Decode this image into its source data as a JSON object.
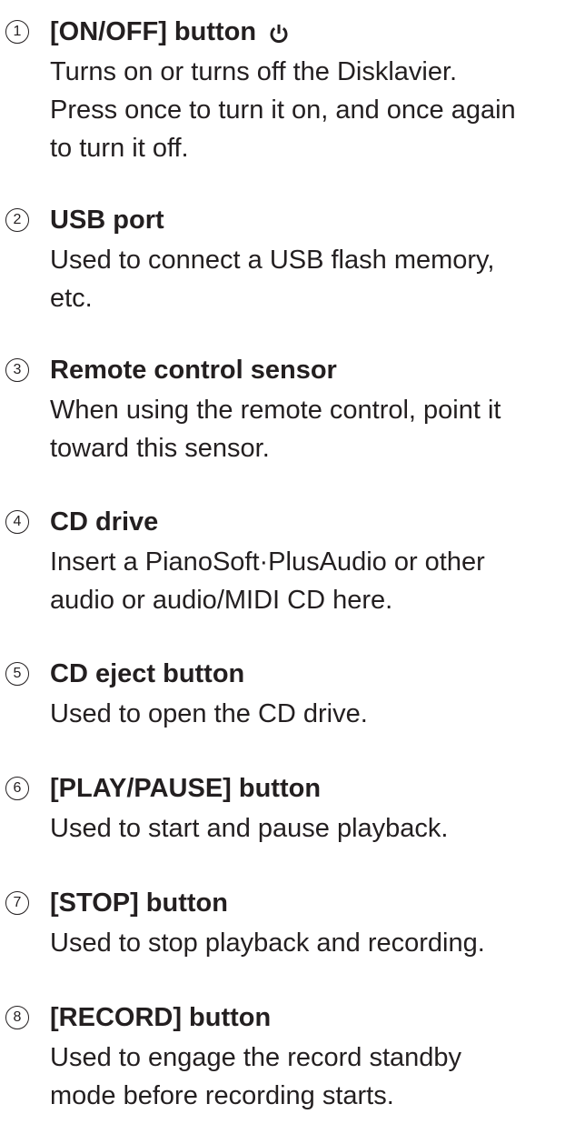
{
  "items": [
    {
      "number": "1",
      "title": "[ON/OFF] button",
      "icon": "power-icon",
      "lines": [
        "Turns on or turns off the Disklavier.",
        "Press once to turn it on, and once again",
        "to turn it off."
      ]
    },
    {
      "number": "2",
      "title": "USB port",
      "lines": [
        "Used to connect a USB flash memory,",
        "etc."
      ]
    },
    {
      "number": "3",
      "title": "Remote control sensor",
      "lines": [
        "When using the remote control, point it",
        "toward this sensor."
      ]
    },
    {
      "number": "4",
      "title": "CD drive",
      "lines": [
        "Insert a PianoSoft·PlusAudio or other",
        "audio or audio/MIDI CD here."
      ]
    },
    {
      "number": "5",
      "title": "CD eject button",
      "lines": [
        "Used to open the CD drive."
      ]
    },
    {
      "number": "6",
      "title": "[PLAY/PAUSE] button",
      "lines": [
        "Used to start and pause playback."
      ]
    },
    {
      "number": "7",
      "title": "[STOP] button",
      "lines": [
        "Used to stop playback and recording."
      ]
    },
    {
      "number": "8",
      "title": "[RECORD] button",
      "lines": [
        "Used to engage the record standby",
        "mode before recording starts."
      ]
    }
  ]
}
